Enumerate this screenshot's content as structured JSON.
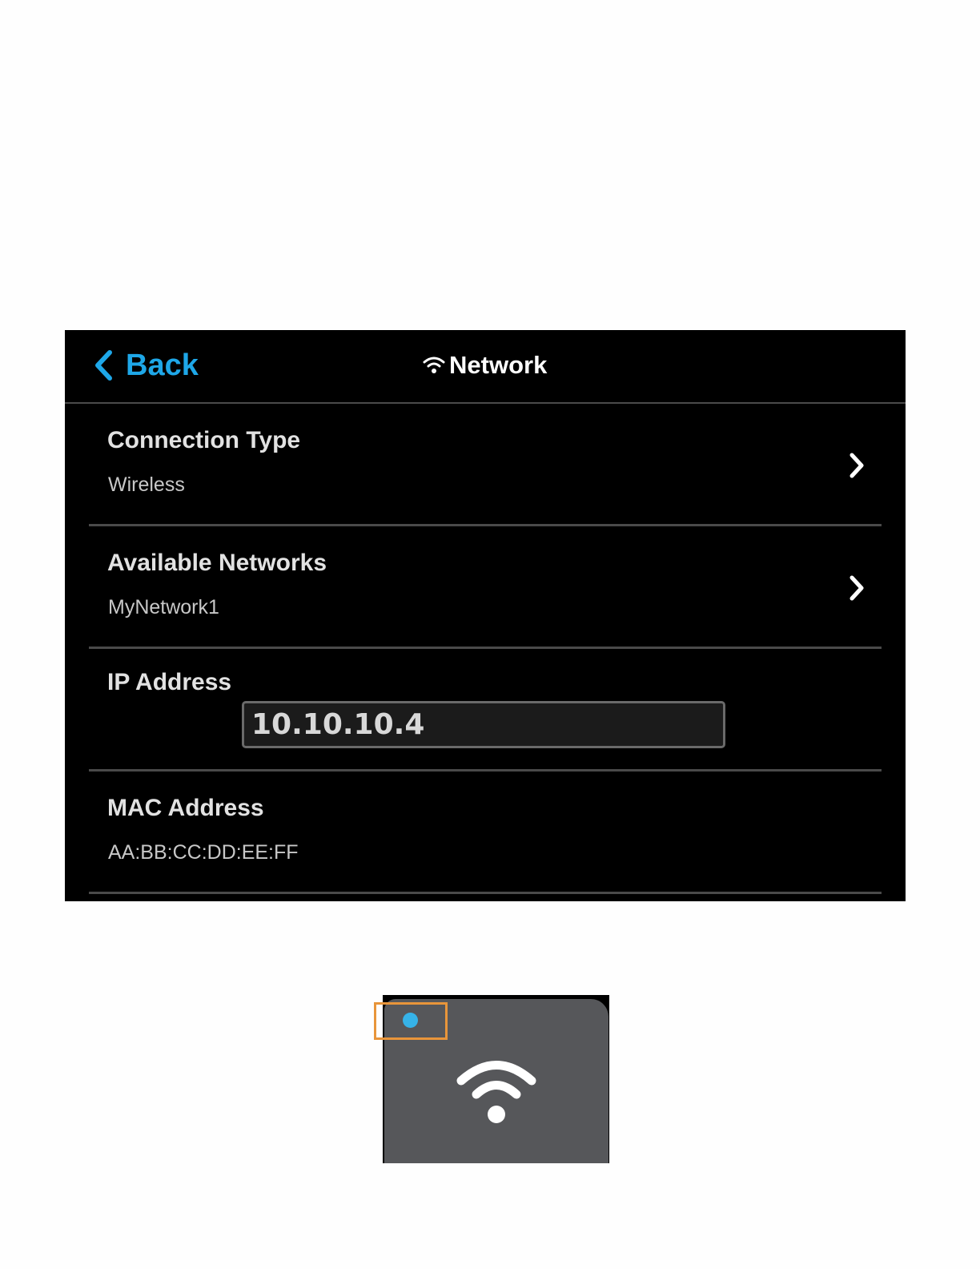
{
  "header": {
    "back_label": "Back",
    "title": "Network",
    "title_icon": "wifi-icon",
    "back_icon": "chevron-left-icon"
  },
  "settings": [
    {
      "title": "Connection Type",
      "value": "Wireless"
    },
    {
      "title": "Available Networks",
      "value": "MyNetwork1"
    },
    {
      "title": "IP Address",
      "value": "10.10.10.4"
    },
    {
      "title": "MAC Address",
      "value": "AA:BB:CC:DD:EE:FF"
    }
  ],
  "status_tile": {
    "icon": "wifi-icon",
    "indicator": "connection-indicator-dot"
  },
  "colors": {
    "accent": "#1ea7e8",
    "screen_bg": "#000000",
    "divider": "#4a4a4a",
    "tile_bg": "#56575a",
    "indicator": "#36b3e8",
    "highlight": "#e8953a"
  }
}
